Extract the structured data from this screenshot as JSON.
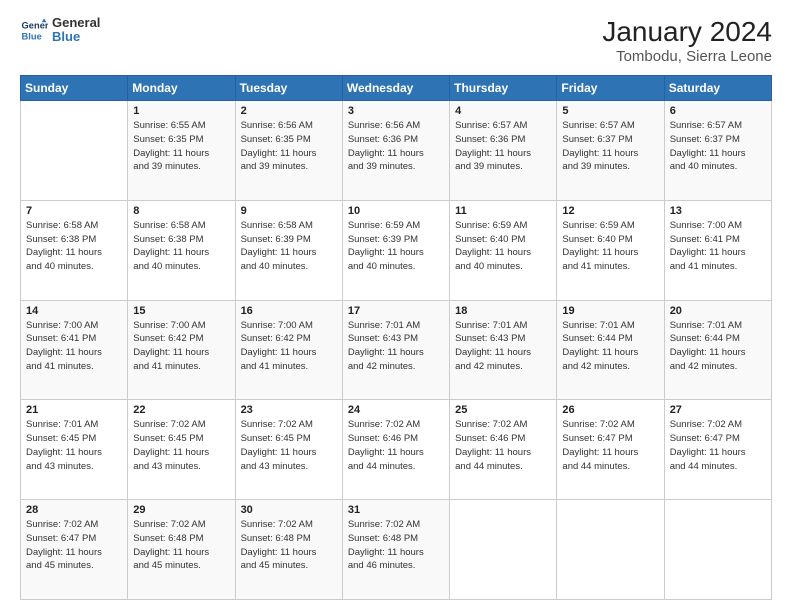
{
  "logo": {
    "line1": "General",
    "line2": "Blue"
  },
  "title": "January 2024",
  "subtitle": "Tombodu, Sierra Leone",
  "days_of_week": [
    "Sunday",
    "Monday",
    "Tuesday",
    "Wednesday",
    "Thursday",
    "Friday",
    "Saturday"
  ],
  "weeks": [
    [
      {
        "day": "",
        "info": ""
      },
      {
        "day": "1",
        "info": "Sunrise: 6:55 AM\nSunset: 6:35 PM\nDaylight: 11 hours\nand 39 minutes."
      },
      {
        "day": "2",
        "info": "Sunrise: 6:56 AM\nSunset: 6:35 PM\nDaylight: 11 hours\nand 39 minutes."
      },
      {
        "day": "3",
        "info": "Sunrise: 6:56 AM\nSunset: 6:36 PM\nDaylight: 11 hours\nand 39 minutes."
      },
      {
        "day": "4",
        "info": "Sunrise: 6:57 AM\nSunset: 6:36 PM\nDaylight: 11 hours\nand 39 minutes."
      },
      {
        "day": "5",
        "info": "Sunrise: 6:57 AM\nSunset: 6:37 PM\nDaylight: 11 hours\nand 39 minutes."
      },
      {
        "day": "6",
        "info": "Sunrise: 6:57 AM\nSunset: 6:37 PM\nDaylight: 11 hours\nand 40 minutes."
      }
    ],
    [
      {
        "day": "7",
        "info": "Sunrise: 6:58 AM\nSunset: 6:38 PM\nDaylight: 11 hours\nand 40 minutes."
      },
      {
        "day": "8",
        "info": "Sunrise: 6:58 AM\nSunset: 6:38 PM\nDaylight: 11 hours\nand 40 minutes."
      },
      {
        "day": "9",
        "info": "Sunrise: 6:58 AM\nSunset: 6:39 PM\nDaylight: 11 hours\nand 40 minutes."
      },
      {
        "day": "10",
        "info": "Sunrise: 6:59 AM\nSunset: 6:39 PM\nDaylight: 11 hours\nand 40 minutes."
      },
      {
        "day": "11",
        "info": "Sunrise: 6:59 AM\nSunset: 6:40 PM\nDaylight: 11 hours\nand 40 minutes."
      },
      {
        "day": "12",
        "info": "Sunrise: 6:59 AM\nSunset: 6:40 PM\nDaylight: 11 hours\nand 41 minutes."
      },
      {
        "day": "13",
        "info": "Sunrise: 7:00 AM\nSunset: 6:41 PM\nDaylight: 11 hours\nand 41 minutes."
      }
    ],
    [
      {
        "day": "14",
        "info": "Sunrise: 7:00 AM\nSunset: 6:41 PM\nDaylight: 11 hours\nand 41 minutes."
      },
      {
        "day": "15",
        "info": "Sunrise: 7:00 AM\nSunset: 6:42 PM\nDaylight: 11 hours\nand 41 minutes."
      },
      {
        "day": "16",
        "info": "Sunrise: 7:00 AM\nSunset: 6:42 PM\nDaylight: 11 hours\nand 41 minutes."
      },
      {
        "day": "17",
        "info": "Sunrise: 7:01 AM\nSunset: 6:43 PM\nDaylight: 11 hours\nand 42 minutes."
      },
      {
        "day": "18",
        "info": "Sunrise: 7:01 AM\nSunset: 6:43 PM\nDaylight: 11 hours\nand 42 minutes."
      },
      {
        "day": "19",
        "info": "Sunrise: 7:01 AM\nSunset: 6:44 PM\nDaylight: 11 hours\nand 42 minutes."
      },
      {
        "day": "20",
        "info": "Sunrise: 7:01 AM\nSunset: 6:44 PM\nDaylight: 11 hours\nand 42 minutes."
      }
    ],
    [
      {
        "day": "21",
        "info": "Sunrise: 7:01 AM\nSunset: 6:45 PM\nDaylight: 11 hours\nand 43 minutes."
      },
      {
        "day": "22",
        "info": "Sunrise: 7:02 AM\nSunset: 6:45 PM\nDaylight: 11 hours\nand 43 minutes."
      },
      {
        "day": "23",
        "info": "Sunrise: 7:02 AM\nSunset: 6:45 PM\nDaylight: 11 hours\nand 43 minutes."
      },
      {
        "day": "24",
        "info": "Sunrise: 7:02 AM\nSunset: 6:46 PM\nDaylight: 11 hours\nand 44 minutes."
      },
      {
        "day": "25",
        "info": "Sunrise: 7:02 AM\nSunset: 6:46 PM\nDaylight: 11 hours\nand 44 minutes."
      },
      {
        "day": "26",
        "info": "Sunrise: 7:02 AM\nSunset: 6:47 PM\nDaylight: 11 hours\nand 44 minutes."
      },
      {
        "day": "27",
        "info": "Sunrise: 7:02 AM\nSunset: 6:47 PM\nDaylight: 11 hours\nand 44 minutes."
      }
    ],
    [
      {
        "day": "28",
        "info": "Sunrise: 7:02 AM\nSunset: 6:47 PM\nDaylight: 11 hours\nand 45 minutes."
      },
      {
        "day": "29",
        "info": "Sunrise: 7:02 AM\nSunset: 6:48 PM\nDaylight: 11 hours\nand 45 minutes."
      },
      {
        "day": "30",
        "info": "Sunrise: 7:02 AM\nSunset: 6:48 PM\nDaylight: 11 hours\nand 45 minutes."
      },
      {
        "day": "31",
        "info": "Sunrise: 7:02 AM\nSunset: 6:48 PM\nDaylight: 11 hours\nand 46 minutes."
      },
      {
        "day": "",
        "info": ""
      },
      {
        "day": "",
        "info": ""
      },
      {
        "day": "",
        "info": ""
      }
    ]
  ]
}
